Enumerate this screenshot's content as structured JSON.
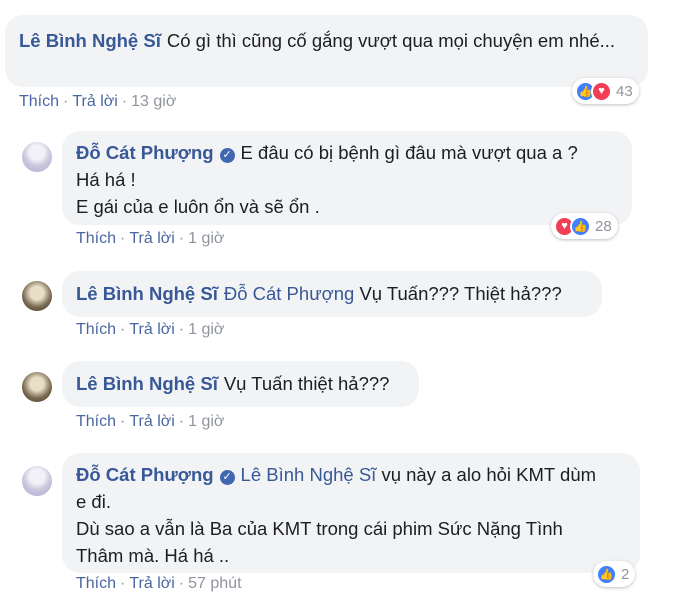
{
  "comments": [
    {
      "author": "Lê Bình Nghệ Sĩ",
      "text": "Có gì thì cũng cố gắng vượt qua mọi chuyện em nhé...",
      "actions": {
        "like": "Thích",
        "reply": "Trả lời",
        "time": "13 giờ"
      },
      "reactions": {
        "count": "43",
        "icons": [
          "like-icon",
          "love-icon"
        ]
      }
    },
    {
      "author": "Đỗ Cát Phượng",
      "verified": true,
      "lines": [
        "E đâu có bị bệnh gì đâu mà vượt qua a ?",
        "Há há !",
        "E gái của e luôn ổn và sẽ ổn ."
      ],
      "actions": {
        "like": "Thích",
        "reply": "Trả lời",
        "time": "1 giờ"
      },
      "reactions": {
        "count": "28",
        "icons": [
          "love-icon",
          "like-icon"
        ]
      }
    },
    {
      "author": "Lê Bình Nghệ Sĩ",
      "mention": "Đỗ Cát Phượng",
      "text": "Vụ Tuấn??? Thiệt hả???",
      "actions": {
        "like": "Thích",
        "reply": "Trả lời",
        "time": "1 giờ"
      }
    },
    {
      "author": "Lê Bình Nghệ Sĩ",
      "text": "Vụ Tuấn thiệt hả???",
      "actions": {
        "like": "Thích",
        "reply": "Trả lời",
        "time": "1 giờ"
      }
    },
    {
      "author": "Đỗ Cát Phượng",
      "verified": true,
      "mention": "Lê Bình Nghệ Sĩ",
      "text_first": "vụ này a alo hỏi KMT dùm",
      "lines": [
        "e đi.",
        "Dù sao a vẫn là Ba của KMT trong cái phim Sức Nặng Tình",
        "Thâm mà. Há há .."
      ],
      "actions": {
        "like": "Thích",
        "reply": "Trả lời",
        "time": "57 phút"
      },
      "reactions": {
        "count": "2",
        "icons": [
          "like-icon"
        ]
      }
    }
  ],
  "separator": "·",
  "colors": {
    "link": "#385898",
    "bubble": "#f2f3f5",
    "meta": "#90949c",
    "like": "#4080ff",
    "love": "#f33e58"
  }
}
